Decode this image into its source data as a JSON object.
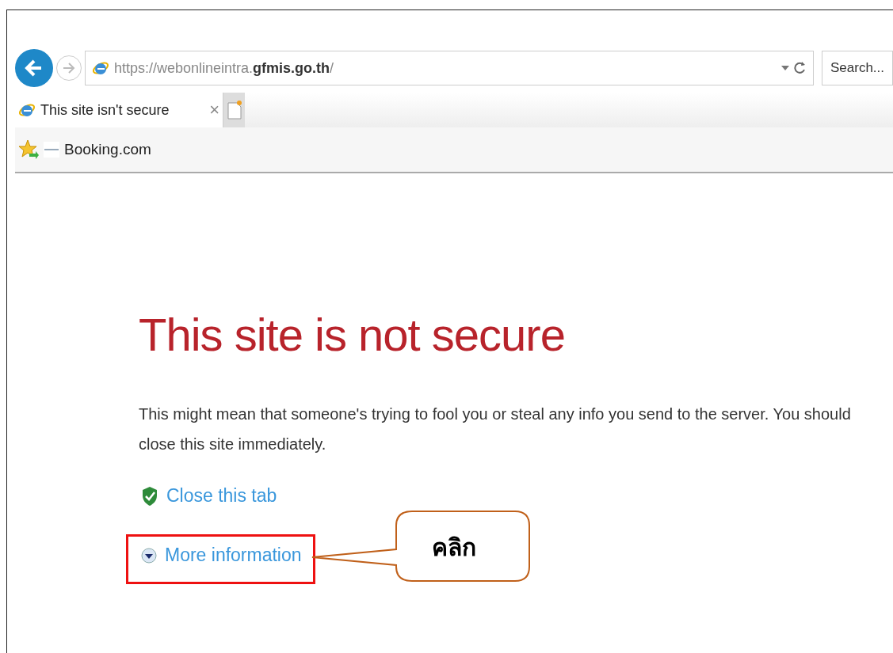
{
  "address_bar": {
    "url": "https://webonlineintra.**gfmis.go.th**/"
  },
  "search": {
    "placeholder": "Search..."
  },
  "tabs": [
    {
      "label": "This site isn't secure",
      "selected": true,
      "close": "×"
    }
  ],
  "favorites": [
    {
      "label": "Booking.com"
    }
  ],
  "page": {
    "heading": "This site is not secure",
    "message": "This might mean that someone's trying to fool you or steal any info you send to the server. You should close this site immediately.",
    "links": [
      {
        "kind": "close",
        "label": "Close this tab",
        "highlighted": false
      },
      {
        "kind": "more",
        "label": "More information",
        "highlighted": true
      }
    ]
  },
  "callout": {
    "text": "คลิก"
  }
}
